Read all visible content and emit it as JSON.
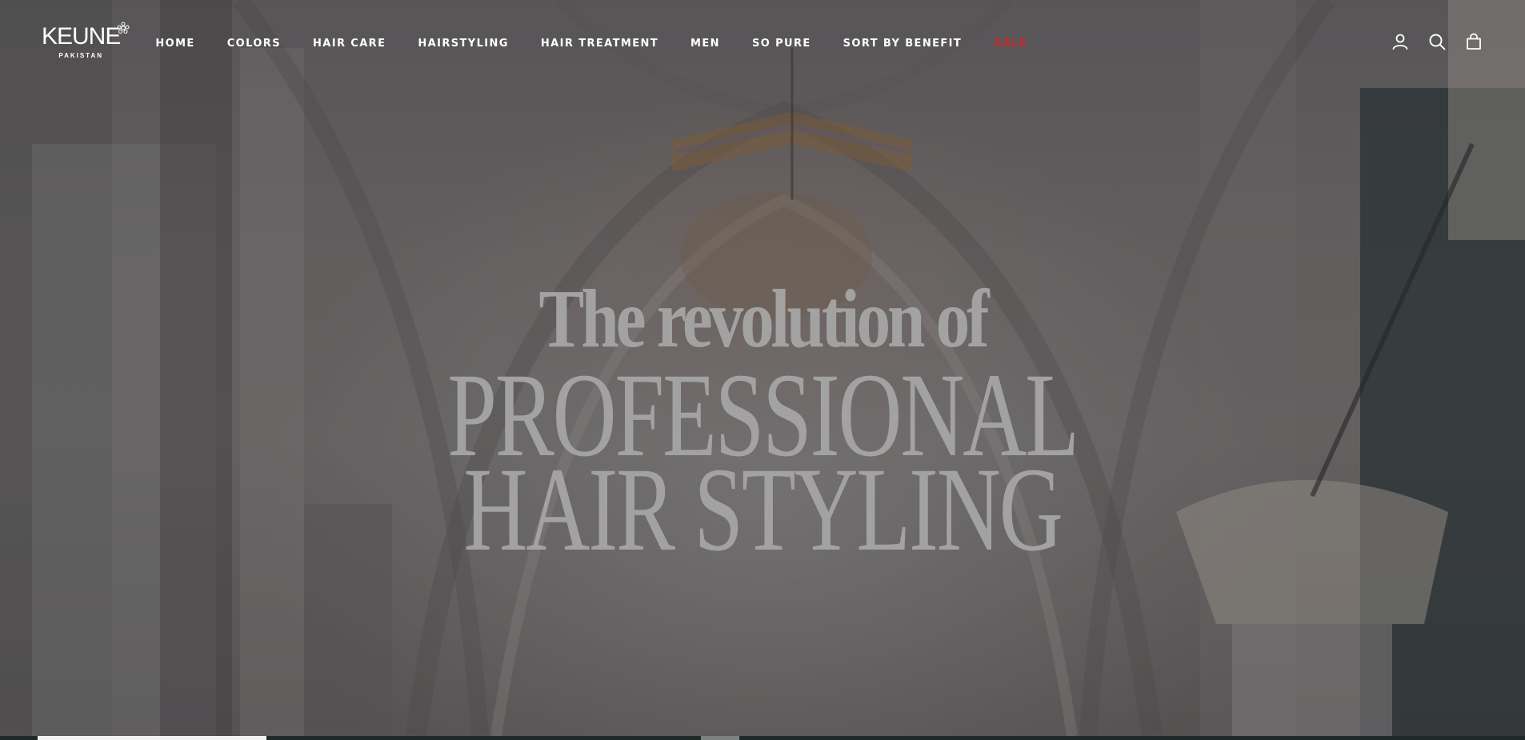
{
  "brand": {
    "name": "KEUNE",
    "region": "PAKISTAN"
  },
  "nav": {
    "items": [
      {
        "label": "HOME"
      },
      {
        "label": "COLORS"
      },
      {
        "label": "HAIR CARE"
      },
      {
        "label": "HAIRSTYLING"
      },
      {
        "label": "HAIR TREATMENT"
      },
      {
        "label": "MEN"
      },
      {
        "label": "SO PURE"
      },
      {
        "label": "SORT BY BENEFIT"
      },
      {
        "label": "SALE"
      }
    ]
  },
  "header_icons": [
    "account-icon",
    "search-icon",
    "cart-bag-icon"
  ],
  "hero": {
    "line1": "The revolution of",
    "line2": "PROFESSIONAL",
    "line3": "HAIR STYLING"
  },
  "slideshow": {
    "progress": 0.15
  },
  "colors": {
    "nav_text": "#ffffff",
    "sale": "#c8292b",
    "headline": "#a3a2a2",
    "progress_track": "#1f2a28",
    "progress_fill": "#f2f2f2"
  }
}
